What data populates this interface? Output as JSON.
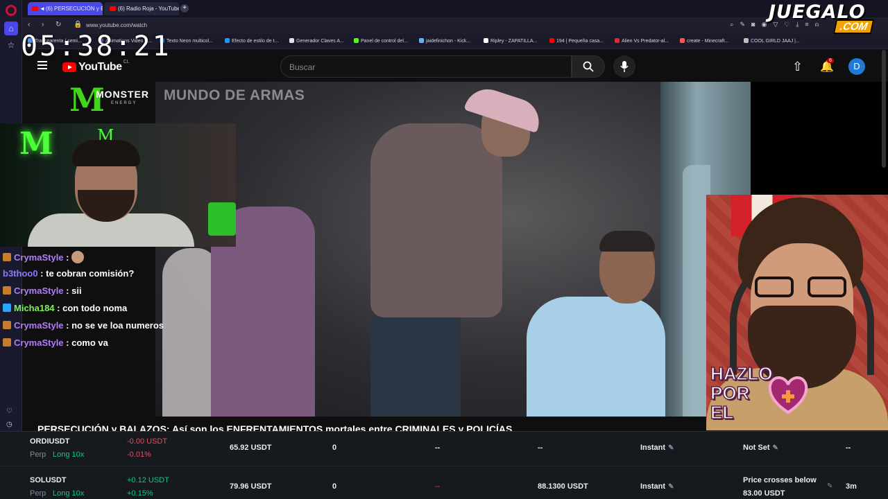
{
  "browser": {
    "tabs": [
      {
        "label": "(6) PERSECUCIÓN y B",
        "active": true
      },
      {
        "label": "(6) Radio Roja - YouTube",
        "active": false
      }
    ],
    "url": "www.youtube.com/watch",
    "bookmarks": [
      {
        "label": "Transparenta / semi...",
        "color": "#5aa0ff"
      },
      {
        "label": "Animations Video C...",
        "color": "#7e57c2"
      },
      {
        "label": "Texto Neon multicol...",
        "color": "#2196f3"
      },
      {
        "label": "Efecto de estilo de t...",
        "color": "#2196f3"
      },
      {
        "label": "Generador Claves A...",
        "color": "#e0e0e0"
      },
      {
        "label": "Panel de control del...",
        "color": "#53fc18"
      },
      {
        "label": "jaidefinichon - Kick...",
        "color": "#64b5f6"
      },
      {
        "label": "Ripley - ZAPATILLA...",
        "color": "#ffffff"
      },
      {
        "label": "194 | Pequeña casa...",
        "color": "#ff0000"
      },
      {
        "label": "Alien Vs Predator-al...",
        "color": "#d32f2f"
      },
      {
        "label": "create - Minecraft...",
        "color": "#ff5252"
      },
      {
        "label": "COOL GIRLD JAAJ |...",
        "color": "#bdbdbd"
      }
    ]
  },
  "overlay": {
    "clock": "05:38:21",
    "brand_top": "JUEGALO",
    "brand_bottom": ".COM",
    "monster_title": "MONSTER",
    "monster_sub": "ENERGY",
    "toon_text": "HAZLO\nPOR\nEL"
  },
  "youtube": {
    "logo_text": "YouTube",
    "country": "CL",
    "search_placeholder": "Buscar",
    "notif_count": "6",
    "avatar_letter": "D",
    "watermark": "MUNDO DE ARMAS",
    "video_title": "PERSECUCIÓN y BALAZOS: Así son los ENFRENTAMIENTOS mortales entre CRIMINALES y POLICÍAS"
  },
  "chat": [
    {
      "user": "CrymaStyle",
      "color": "#b57bff",
      "badge": "#c77d2e",
      "message": "",
      "emote": true
    },
    {
      "user": "b3thoo0",
      "color": "#8b7bff",
      "badge": "",
      "message": "te cobran comisión?",
      "emote": false
    },
    {
      "user": "CrymaStyle",
      "color": "#b57bff",
      "badge": "#c77d2e",
      "message": "sii",
      "emote": false
    },
    {
      "user": "Micha184",
      "color": "#7df25f",
      "badge": "#2ba6ff",
      "message": "con todo noma",
      "emote": false
    },
    {
      "user": "CrymaStyle",
      "color": "#b57bff",
      "badge": "#c77d2e",
      "message": "no se ve loa numeros",
      "emote": false
    },
    {
      "user": "CrymaStyle",
      "color": "#b57bff",
      "badge": "#c77d2e",
      "message": "como va",
      "emote": false
    }
  ],
  "trading": {
    "rows": [
      {
        "symbol": "ORDIUSDT",
        "type": "Perp",
        "leverage": "Long 10x",
        "pnl": "-0.00 USDT",
        "pnl_pct": "-0.01%",
        "pnl_sign": "neg",
        "margin": "65.92 USDT",
        "col3": "0",
        "col4": "--",
        "col5": "--",
        "mode": "Instant",
        "trigger": "Not Set",
        "trigger2": "",
        "last": "--"
      },
      {
        "symbol": "SOLUSDT",
        "type": "Perp",
        "leverage": "Long 10x",
        "pnl": "+0.12 USDT",
        "pnl_pct": "+0.15%",
        "pnl_sign": "pos",
        "margin": "79.96 USDT",
        "col3": "0",
        "col4": "--",
        "col5": "88.1300 USDT",
        "mode": "Instant",
        "trigger": "Price crosses below",
        "trigger2": "83.00 USDT",
        "last": "3m"
      }
    ]
  }
}
